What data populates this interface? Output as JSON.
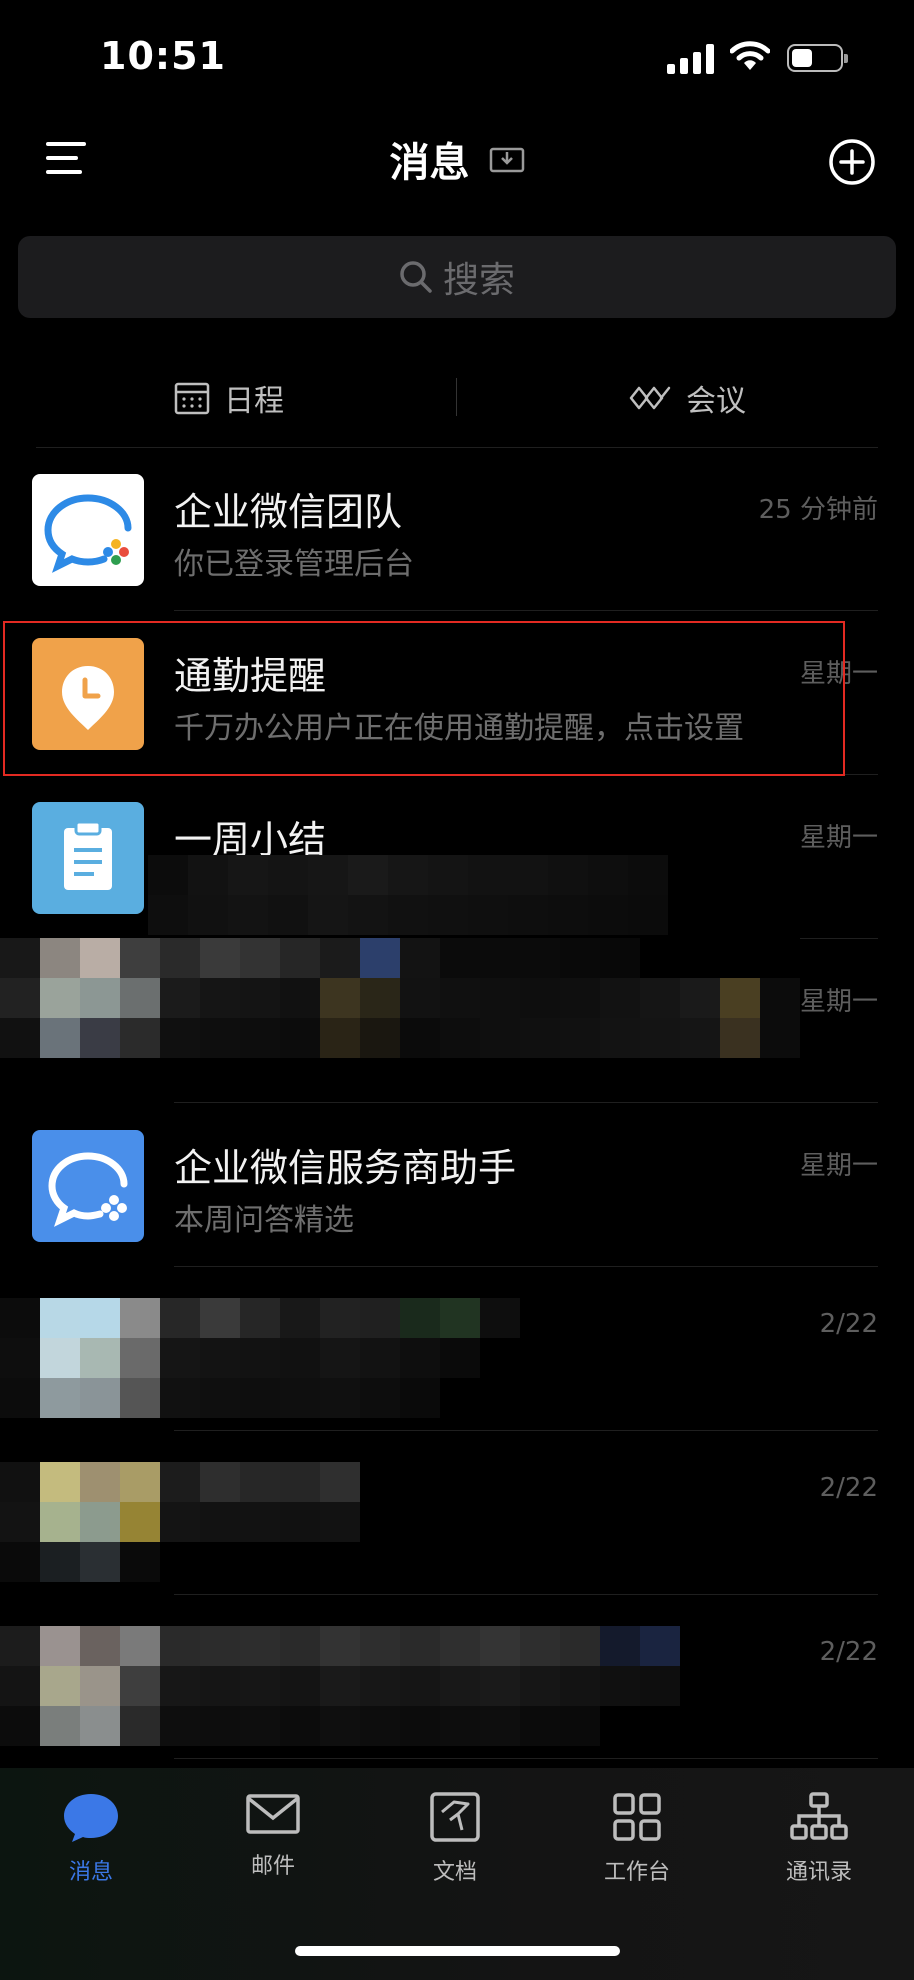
{
  "status_bar": {
    "time": "10:51"
  },
  "header": {
    "title": "消息"
  },
  "search": {
    "placeholder": "搜索"
  },
  "quick_actions": [
    {
      "label": "日程",
      "icon": "calendar-icon"
    },
    {
      "label": "会议",
      "icon": "meeting-icon"
    }
  ],
  "conversations": [
    {
      "name": "企业微信团队",
      "preview": "你已登录管理后台",
      "time": "25 分钟前",
      "icon": "wecom-chat-icon"
    },
    {
      "name": "通勤提醒",
      "preview": "千万办公用户正在使用通勤提醒，点击设置",
      "time": "星期一",
      "icon": "clock-pin-icon"
    },
    {
      "name": "一周小结",
      "preview": "",
      "time": "星期一",
      "icon": "clipboard-icon"
    },
    {
      "name": "",
      "preview": "",
      "time": "星期一"
    },
    {
      "name": "企业微信服务商助手",
      "preview": "本周问答精选",
      "time": "星期一",
      "icon": "wecom-chat-icon"
    },
    {
      "name": "",
      "preview": "",
      "time": "2/22"
    },
    {
      "name": "",
      "preview": "",
      "time": "2/22"
    },
    {
      "name": "",
      "preview": "",
      "time": "2/22"
    }
  ],
  "tab_bar": [
    {
      "label": "消息",
      "icon": "message-icon",
      "active": true
    },
    {
      "label": "邮件",
      "icon": "mail-icon"
    },
    {
      "label": "文档",
      "icon": "document-icon"
    },
    {
      "label": "工作台",
      "icon": "workbench-icon"
    },
    {
      "label": "通讯录",
      "icon": "contacts-icon"
    }
  ],
  "colors": {
    "accent": "#3b78e7",
    "highlight": "#e32a22",
    "orange": "#f0a24a",
    "light_blue": "#5aaee0",
    "blue": "#4a8fea"
  }
}
